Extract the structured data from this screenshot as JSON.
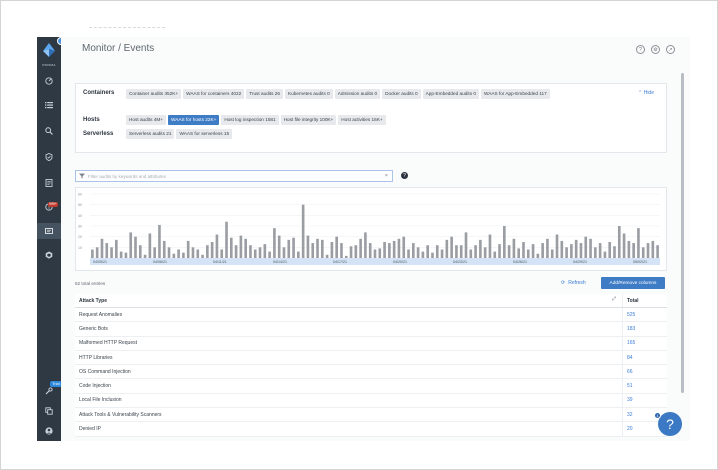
{
  "window": {
    "page_title": "Monitor / Events"
  },
  "sidebar": {
    "brand": "PRISMA",
    "items": [
      {
        "icon": "radar-icon"
      },
      {
        "icon": "list-icon"
      },
      {
        "icon": "search-icon"
      },
      {
        "icon": "shield-check-icon"
      },
      {
        "icon": "report-icon"
      },
      {
        "icon": "alert-icon",
        "badge": "999+"
      },
      {
        "icon": "events-icon",
        "active": true
      },
      {
        "icon": "box-icon"
      }
    ],
    "bottom": [
      {
        "icon": "wrench-icon",
        "badge": "Trial"
      },
      {
        "icon": "layers-icon"
      },
      {
        "icon": "user-icon"
      }
    ]
  },
  "filters": {
    "hide_label": "Hide",
    "groups": [
      {
        "label": "Containers",
        "chips": [
          {
            "text": "Container audits  352K+"
          },
          {
            "text": "WAAS for containers  4022"
          },
          {
            "text": "Trust audits  26"
          },
          {
            "text": "Kubernetes audits  0"
          },
          {
            "text": "Admission audits  0"
          },
          {
            "text": "Docker audits  0"
          },
          {
            "text": "App-Embedded audits  0"
          },
          {
            "text": "WAAS for App-Embedded  117"
          }
        ]
      },
      {
        "label": "Hosts",
        "chips": [
          {
            "text": "Host audits  4M+"
          },
          {
            "text": "WAAS for hosts  22K+",
            "selected": true
          },
          {
            "text": "Host log inspection  1581"
          },
          {
            "text": "Host file integrity  100K+"
          },
          {
            "text": "Host activities  16K+"
          }
        ]
      },
      {
        "label": "Serverless",
        "chips": [
          {
            "text": "Serverless audits  21"
          },
          {
            "text": "WAAS for serverless  15"
          }
        ]
      }
    ]
  },
  "search": {
    "placeholder": "Filter audits by keywords and attributes",
    "clear": "×"
  },
  "chart_data": {
    "type": "bar",
    "ylim": [
      0,
      60
    ],
    "yticks": [
      "60",
      "50",
      "40",
      "30",
      "20",
      "10"
    ],
    "xticks": [
      "04/05/21",
      "04/08/21",
      "04/11/21",
      "04/14/21",
      "04/17/21",
      "04/20/21",
      "04/23/21",
      "04/26/21",
      "04/29/21",
      "05/02/21"
    ],
    "values": [
      8,
      10,
      18,
      14,
      10,
      17,
      6,
      5,
      24,
      20,
      12,
      3,
      23,
      10,
      31,
      16,
      10,
      4,
      8,
      5,
      16,
      10,
      8,
      3,
      12,
      15,
      22,
      8,
      34,
      19,
      12,
      21,
      18,
      12,
      8,
      10,
      13,
      6,
      28,
      21,
      10,
      17,
      19,
      6,
      50,
      21,
      14,
      18,
      17,
      3,
      15,
      20,
      14,
      2,
      11,
      12,
      18,
      24,
      14,
      8,
      9,
      15,
      14,
      16,
      18,
      20,
      8,
      14,
      10,
      6,
      12,
      5,
      12,
      8,
      17,
      20,
      12,
      12,
      24,
      8,
      12,
      17,
      10,
      22,
      6,
      13,
      30,
      12,
      18,
      9,
      15,
      8,
      13,
      4,
      14,
      18,
      8,
      22,
      16,
      10,
      13,
      17,
      14,
      20,
      18,
      10,
      14,
      6,
      15,
      11,
      30,
      23,
      16,
      14,
      28,
      10,
      14,
      16,
      12
    ]
  },
  "table_meta": {
    "total_entries": "52 total entries",
    "refresh_label": "Refresh",
    "add_remove_label": "Add/Remove columns"
  },
  "table": {
    "headers": [
      "Attack Type",
      "Total"
    ],
    "rows": [
      [
        "Request Anomalies",
        "525"
      ],
      [
        "Generic Bots",
        "183"
      ],
      [
        "Malformed HTTP Request",
        "165"
      ],
      [
        "HTTP Libraries",
        "84"
      ],
      [
        "OS Command Injection",
        "66"
      ],
      [
        "Code Injection",
        "51"
      ],
      [
        "Local File Inclusion",
        "39"
      ],
      [
        "Attack Tools & Vulnerability Scanners",
        "32"
      ],
      [
        "Denied IP",
        "20"
      ]
    ]
  },
  "help": {
    "label": "?",
    "badge": "1"
  }
}
